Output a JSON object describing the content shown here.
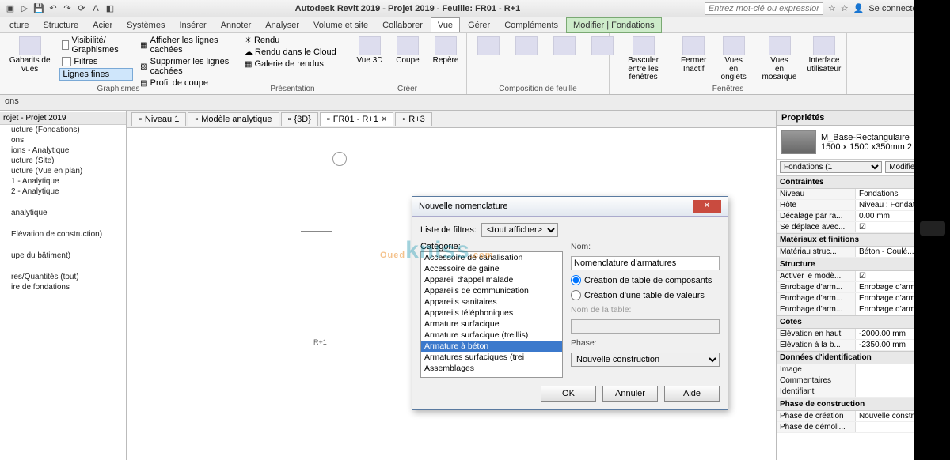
{
  "title": "Autodesk Revit 2019 - Projet 2019 - Feuille: FR01 - R+1",
  "search_placeholder": "Entrez mot-clé ou expression",
  "signin": "Se connecter",
  "menus": [
    "cture",
    "Structure",
    "Acier",
    "Systèmes",
    "Insérer",
    "Annoter",
    "Analyser",
    "Volume et site",
    "Collaborer",
    "Vue",
    "Gérer",
    "Compléments",
    "Modifier | Fondations"
  ],
  "active_menu": 9,
  "mod_menu": 12,
  "ribbon": {
    "graphismes": {
      "gabarits": "Gabarits\nde vues",
      "items": [
        "Visibilité/ Graphismes",
        "Filtres",
        "Lignes fines",
        "Afficher les lignes cachées",
        "Supprimer les lignes cachées",
        "Profil de coupe"
      ],
      "label": "Graphismes"
    },
    "presentation": {
      "items": [
        "Rendu",
        "Rendu dans le Cloud",
        "Galerie de rendus"
      ],
      "label": "Présentation"
    },
    "creer": {
      "items": [
        "Vue\n3D",
        "Coupe",
        "Repère"
      ],
      "label": "Créer"
    },
    "compo": {
      "label": "Composition de feuille"
    },
    "fenetres": {
      "items": [
        "Basculer\nentre les fenêtres",
        "Fermer\nInactif",
        "Vues\nen onglets",
        "Vues\nen mosaïque",
        "Interface\nutilisateur"
      ],
      "label": "Fenêtres"
    }
  },
  "optionsbar": "ons",
  "browser": {
    "header": "rojet - Projet 2019",
    "nodes": [
      "ucture (Fondations)",
      "ons",
      "ions - Analytique",
      "ucture (Site)",
      "ucture (Vue en plan)",
      "1 - Analytique",
      "2 - Analytique",
      "",
      "analytique",
      "",
      "Elévation de construction)",
      "",
      "upe du bâtiment)",
      "",
      "res/Quantités (tout)",
      "ire de fondations"
    ]
  },
  "viewtabs": [
    {
      "label": "Niveau 1",
      "icon": "plan"
    },
    {
      "label": "Modèle analytique",
      "icon": "cube"
    },
    {
      "label": "{3D}",
      "icon": "cube"
    },
    {
      "label": "FR01 - R+1",
      "icon": "sheet",
      "active": true,
      "closable": true
    },
    {
      "label": "R+3",
      "icon": "sheet"
    }
  ],
  "sheet_tag": "R+1",
  "props": {
    "title": "Propriétés",
    "family": "M_Base-Rectangulaire",
    "type": "1500 x 1500 x350mm 2",
    "typesel": "Fondations (1",
    "edit_type": "Modifier le type",
    "sections": {
      "Contraintes": [
        [
          "Niveau",
          "Fondations"
        ],
        [
          "Hôte",
          "Niveau : Fondati..."
        ],
        [
          "Décalage par ra...",
          "0.00 mm"
        ],
        [
          "Se déplace avec...",
          "☑"
        ]
      ],
      "Matériaux et finitions": [
        [
          "Matériau struc...",
          "Béton - Coulé..."
        ]
      ],
      "Structure": [
        [
          "Activer le modè...",
          "☑"
        ],
        [
          "Enrobage d'arm...",
          "Enrobage d'arm..."
        ],
        [
          "Enrobage d'arm...",
          "Enrobage d'arm..."
        ],
        [
          "Enrobage d'arm...",
          "Enrobage d'arm..."
        ]
      ],
      "Cotes": [
        [
          "Elévation en haut",
          "-2000.00 mm"
        ],
        [
          "Elévation à la b...",
          "-2350.00 mm"
        ]
      ],
      "Données d'identification": [
        [
          "Image",
          ""
        ],
        [
          "Commentaires",
          ""
        ],
        [
          "Identifiant",
          ""
        ]
      ],
      "Phase de construction": [
        [
          "Phase de création",
          "Nouvelle constr..."
        ],
        [
          "Phase de démoli...",
          ""
        ]
      ]
    }
  },
  "dialog": {
    "title": "Nouvelle nomenclature",
    "filter_label": "Liste de filtres:",
    "filter_value": "<tout afficher>",
    "cat_label": "Catégorie:",
    "categories": [
      "Accessoire de canalisation",
      "Accessoire de gaine",
      "Appareil d'appel malade",
      "Appareils de communication",
      "Appareils sanitaires",
      "Appareils téléphoniques",
      "Armature surfacique",
      "Armature surfacique (treillis)",
      "Armature à béton",
      "Armatures surfaciques (trei",
      "Assemblages"
    ],
    "selected_cat": 8,
    "name_label": "Nom:",
    "name_value": "Nomenclature d'armatures",
    "radio1": "Création de table de composants",
    "radio2": "Création d'une table de valeurs",
    "tablename_label": "Nom de la table:",
    "phase_label": "Phase:",
    "phase_value": "Nouvelle construction",
    "ok": "OK",
    "cancel": "Annuler",
    "help": "Aide"
  },
  "watermark": "Ouedkniss.com"
}
